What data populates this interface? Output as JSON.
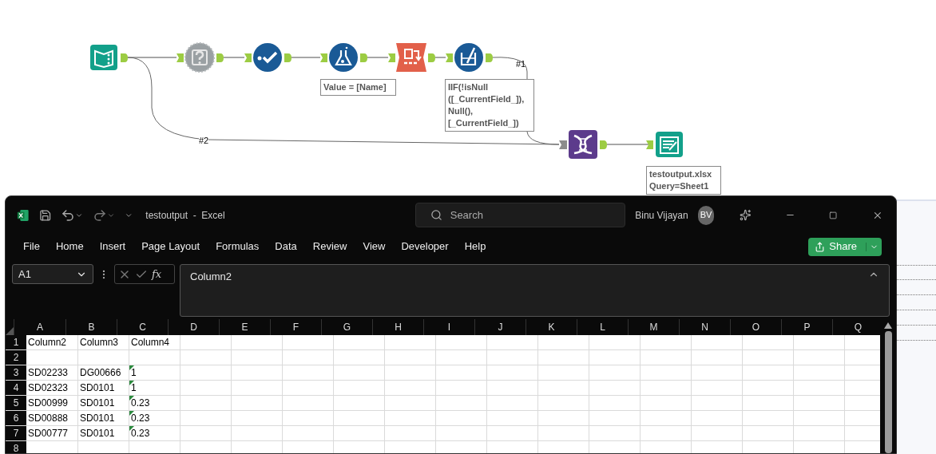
{
  "workflow": {
    "nodes": [
      {
        "kind": "input"
      },
      {
        "kind": "test"
      },
      {
        "kind": "select"
      },
      {
        "kind": "formula",
        "annotation": "Value = [Name]"
      },
      {
        "kind": "transpose"
      },
      {
        "kind": "multifield",
        "annotation": "IIF(!isNull ([_CurrentField_]), Null(), [_CurrentField_])"
      },
      {
        "kind": "join"
      },
      {
        "kind": "output",
        "annotation": "testoutput.xlsx Query=Sheet1"
      }
    ],
    "connection_labels": [
      "#1",
      "#2"
    ]
  },
  "excel": {
    "title": "testoutput  -  Excel",
    "search": {
      "placeholder": "Search"
    },
    "user": {
      "name": "Binu Vijayan",
      "initials": "BV"
    },
    "menu": [
      "File",
      "Home",
      "Insert",
      "Page Layout",
      "Formulas",
      "Data",
      "Review",
      "View",
      "Developer",
      "Help"
    ],
    "share_button": "Share",
    "name_box": "A1",
    "fx": "fx",
    "formula": "Column2",
    "columns": [
      "A",
      "B",
      "C",
      "D",
      "E",
      "F",
      "G",
      "H",
      "I",
      "J",
      "K",
      "L",
      "M",
      "N",
      "O",
      "P",
      "Q"
    ],
    "rows": [
      {
        "number": "1",
        "cells": [
          {
            "text": "Column2"
          },
          {
            "text": "Column3"
          },
          {
            "text": "Column4",
            "flagged": false
          }
        ]
      },
      {
        "number": "2",
        "cells": []
      },
      {
        "number": "3",
        "cells": [
          {
            "text": "SD02233"
          },
          {
            "text": "DG00666"
          },
          {
            "text": "1",
            "flagged": true
          }
        ]
      },
      {
        "number": "4",
        "cells": [
          {
            "text": "SD02323"
          },
          {
            "text": "SD0101"
          },
          {
            "text": "1",
            "flagged": true
          }
        ]
      },
      {
        "number": "5",
        "cells": [
          {
            "text": "SD00999"
          },
          {
            "text": "SD0101"
          },
          {
            "text": "0.23",
            "flagged": true
          }
        ]
      },
      {
        "number": "6",
        "cells": [
          {
            "text": "SD00888"
          },
          {
            "text": "SD0101"
          },
          {
            "text": "0.23",
            "flagged": true
          }
        ]
      },
      {
        "number": "7",
        "cells": [
          {
            "text": "SD00777"
          },
          {
            "text": "SD0101"
          },
          {
            "text": "0.23",
            "flagged": true
          }
        ]
      },
      {
        "number": "8",
        "cells": []
      }
    ]
  }
}
